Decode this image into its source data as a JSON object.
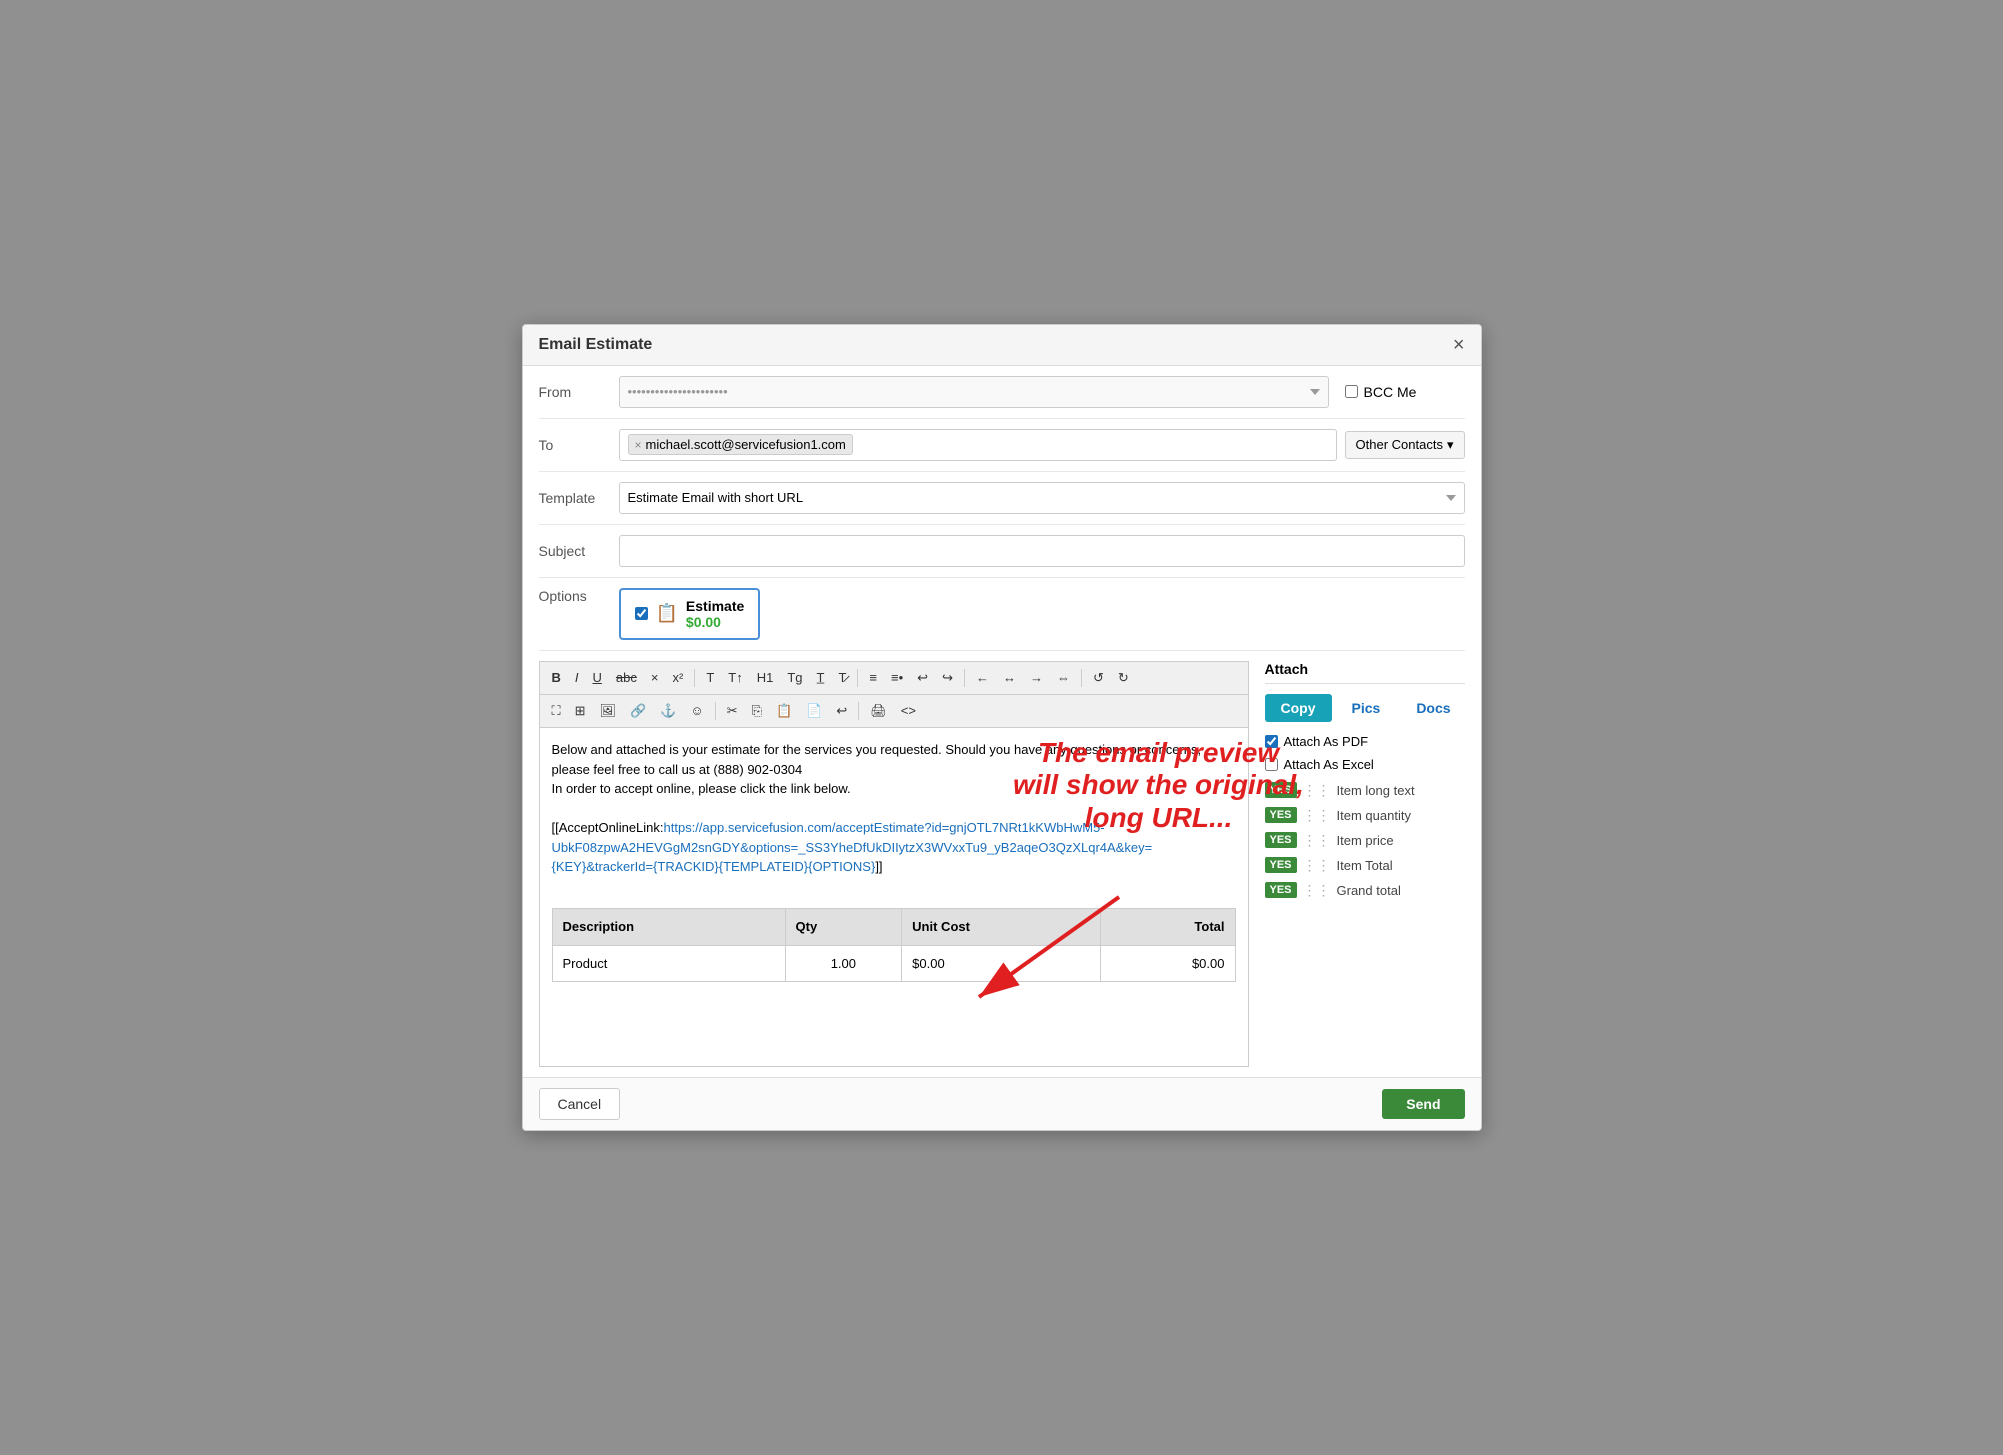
{
  "modal": {
    "title": "Email Estimate",
    "close_icon": "×"
  },
  "form": {
    "from_label": "From",
    "from_placeholder": "••••••••••••••••••••••",
    "bcc_label": "BCC Me",
    "to_label": "To",
    "to_email": "michael.scott@servicefusion1.com",
    "other_contacts_label": "Other Contacts",
    "template_label": "Template",
    "template_value": "Estimate Email with short URL",
    "subject_label": "Subject",
    "subject_value": "",
    "options_label": "Options"
  },
  "estimate_card": {
    "name": "Estimate",
    "amount": "$0.00"
  },
  "toolbar": {
    "row1": [
      "B",
      "I",
      "U",
      "abc",
      "×",
      "x²",
      "T",
      "T↑",
      "H1",
      "Tg",
      "T̲",
      "T̷",
      "≡",
      "≡•",
      "↩",
      "↪",
      "←",
      "→",
      "↑",
      "↓",
      "⊞",
      "⊟",
      "⊠",
      "⊡",
      "↺",
      "↻"
    ],
    "row2": [
      "≡",
      "⬛",
      "▣",
      "🔗",
      "⌂",
      "☺",
      "✂",
      "⎘",
      "📋",
      "🖨",
      "↩",
      "⎙",
      "<>"
    ]
  },
  "editor": {
    "body_text": "Below and attached is your estimate for the services you requested. Should you have any questions or concerns, please feel free to call us at (888) 902-0304\nIn order to accept online, please click the link below.",
    "link_prefix": "[[AcceptOnlineLink:",
    "link_url": "https://app.servicefusion.com/acceptEstimate?id=gnjOTL7NRt1kKWbHwM5-UbkF08zpwA2HEVGgM2snGDY&options=_SS3YheDfUkDIIytzX3WVxxTu9_yB2aqeO3QzXLqr4A&key={KEY}&trackerId={TRACKID}{TEMPLATEID}{OPTIONS}",
    "link_suffix": "]]",
    "table": {
      "headers": [
        "Description",
        "Qty",
        "Unit Cost",
        "Total"
      ],
      "rows": [
        [
          "Product",
          "1.00",
          "$0.00",
          "$0.00"
        ]
      ]
    }
  },
  "annotation": {
    "text": "The email preview\nwill show the original,\nlong URL..."
  },
  "attach": {
    "title": "Attach",
    "tabs": [
      {
        "label": "Copy",
        "active": true
      },
      {
        "label": "Pics",
        "active": false
      },
      {
        "label": "Docs",
        "active": false
      }
    ],
    "attach_pdf_label": "Attach As PDF",
    "attach_excel_label": "Attach As Excel",
    "toggles": [
      {
        "label": "Item long text",
        "value": "YES"
      },
      {
        "label": "Item quantity",
        "value": "YES"
      },
      {
        "label": "Item price",
        "value": "YES"
      },
      {
        "label": "Item Total",
        "value": "YES"
      },
      {
        "label": "Grand total",
        "value": "YES"
      }
    ]
  },
  "footer": {
    "cancel_label": "Cancel",
    "send_label": "Send"
  }
}
